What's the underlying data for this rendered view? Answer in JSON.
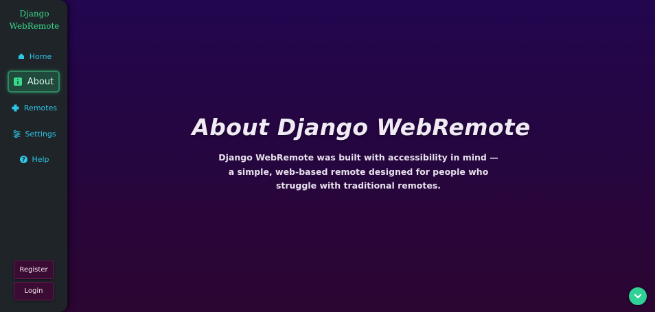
{
  "sidebar": {
    "brand_line1": "Django",
    "brand_line2": "WebRemote",
    "items": [
      {
        "label": "Home",
        "icon": "house-icon",
        "active": false
      },
      {
        "label": "About",
        "icon": "info-icon",
        "active": true
      },
      {
        "label": "Remotes",
        "icon": "gamepad-icon",
        "active": false
      },
      {
        "label": "Settings",
        "icon": "sliders-icon",
        "active": false
      },
      {
        "label": "Help",
        "icon": "question-circle-icon",
        "active": false
      }
    ],
    "register_label": "Register",
    "login_label": "Login"
  },
  "hero": {
    "title": "About Django WebRemote",
    "description": "Django WebRemote was built with accessibility in mind — a simple, web-based remote designed for people who struggle with traditional remotes."
  },
  "scroll_button": {
    "icon": "chevron-down-icon"
  },
  "colors": {
    "brand": "#39d98a",
    "nav_link": "#2ec6e6",
    "active_bg": "#1f4a3c",
    "sidebar_bg": "#1f2428",
    "page_bg_top": "#22064f",
    "page_bg_bottom": "#2c0632",
    "button_bg": "#3b0c33",
    "scroll_button_bg": "#2fd196"
  }
}
